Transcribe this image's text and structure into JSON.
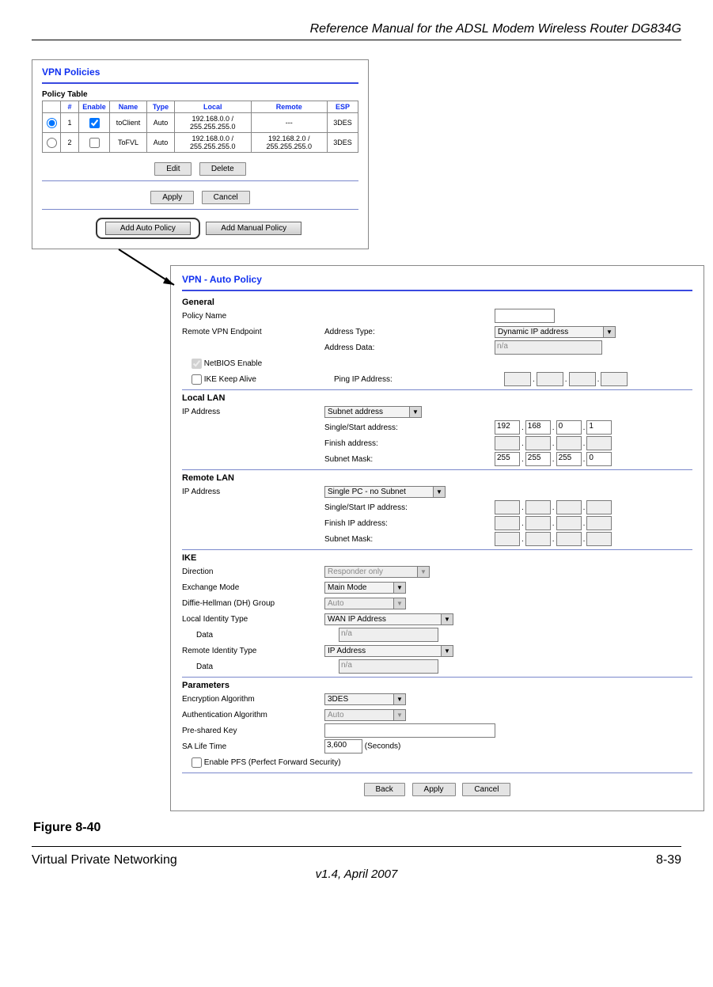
{
  "doc_title": "Reference Manual for the ADSL Modem Wireless Router DG834G",
  "figure_caption": "Figure 8-40",
  "footer": {
    "left": "Virtual Private Networking",
    "right": "8-39",
    "center": "v1.4, April 2007"
  },
  "panel1": {
    "title": "VPN Policies",
    "table_label": "Policy Table",
    "headers": [
      "",
      "#",
      "Enable",
      "Name",
      "Type",
      "Local",
      "Remote",
      "ESP"
    ],
    "rows": [
      {
        "sel": "on",
        "n": "1",
        "en": "on",
        "name": "toClient",
        "type": "Auto",
        "local": "192.168.0.0 /\n255.255.255.0",
        "remote": "---",
        "esp": "3DES"
      },
      {
        "sel": "off",
        "n": "2",
        "en": "off",
        "name": "ToFVL",
        "type": "Auto",
        "local": "192.168.0.0 /\n255.255.255.0",
        "remote": "192.168.2.0 /\n255.255.255.0",
        "esp": "3DES"
      }
    ],
    "buttons": {
      "edit": "Edit",
      "delete": "Delete",
      "apply": "Apply",
      "cancel": "Cancel",
      "add_auto": "Add Auto Policy",
      "add_manual": "Add Manual Policy"
    }
  },
  "panel2": {
    "title": "VPN - Auto Policy",
    "general": {
      "head": "General",
      "policy_name_label": "Policy Name",
      "remote_ep_label": "Remote VPN Endpoint",
      "addr_type_label": "Address Type:",
      "addr_type_value": "Dynamic IP address",
      "addr_data_label": "Address Data:",
      "addr_data_value": "n/a",
      "netbios_label": "NetBIOS Enable",
      "ike_keepalive_label": "IKE Keep Alive",
      "ping_label": "Ping IP Address:"
    },
    "locallan": {
      "head": "Local LAN",
      "ipaddr_label": "IP Address",
      "ipaddr_sel": "Subnet address",
      "single_label": "Single/Start address:",
      "single_vals": [
        "192",
        "168",
        "0",
        "1"
      ],
      "finish_label": "Finish address:",
      "mask_label": "Subnet Mask:",
      "mask_vals": [
        "255",
        "255",
        "255",
        "0"
      ]
    },
    "remotelan": {
      "head": "Remote LAN",
      "ipaddr_label": "IP Address",
      "ipaddr_sel": "Single PC - no Subnet",
      "single_label": "Single/Start IP address:",
      "finish_label": "Finish IP address:",
      "mask_label": "Subnet Mask:"
    },
    "ike": {
      "head": "IKE",
      "direction_label": "Direction",
      "direction_value": "Responder only",
      "exchange_label": "Exchange Mode",
      "exchange_value": "Main Mode",
      "dh_label": "Diffie-Hellman (DH) Group",
      "dh_value": "Auto",
      "localid_label": "Local Identity Type",
      "localid_value": "WAN IP Address",
      "data_label": "Data",
      "local_data_value": "n/a",
      "remoteid_label": "Remote Identity Type",
      "remoteid_value": "IP Address",
      "remote_data_value": "n/a"
    },
    "params": {
      "head": "Parameters",
      "enc_label": "Encryption Algorithm",
      "enc_value": "3DES",
      "auth_label": "Authentication Algorithm",
      "auth_value": "Auto",
      "psk_label": "Pre-shared Key",
      "salife_label": "SA Life Time",
      "salife_value": "3,600",
      "salife_unit": "(Seconds)",
      "pfs_label": "Enable PFS (Perfect Forward Security)"
    },
    "buttons": {
      "back": "Back",
      "apply": "Apply",
      "cancel": "Cancel"
    }
  }
}
